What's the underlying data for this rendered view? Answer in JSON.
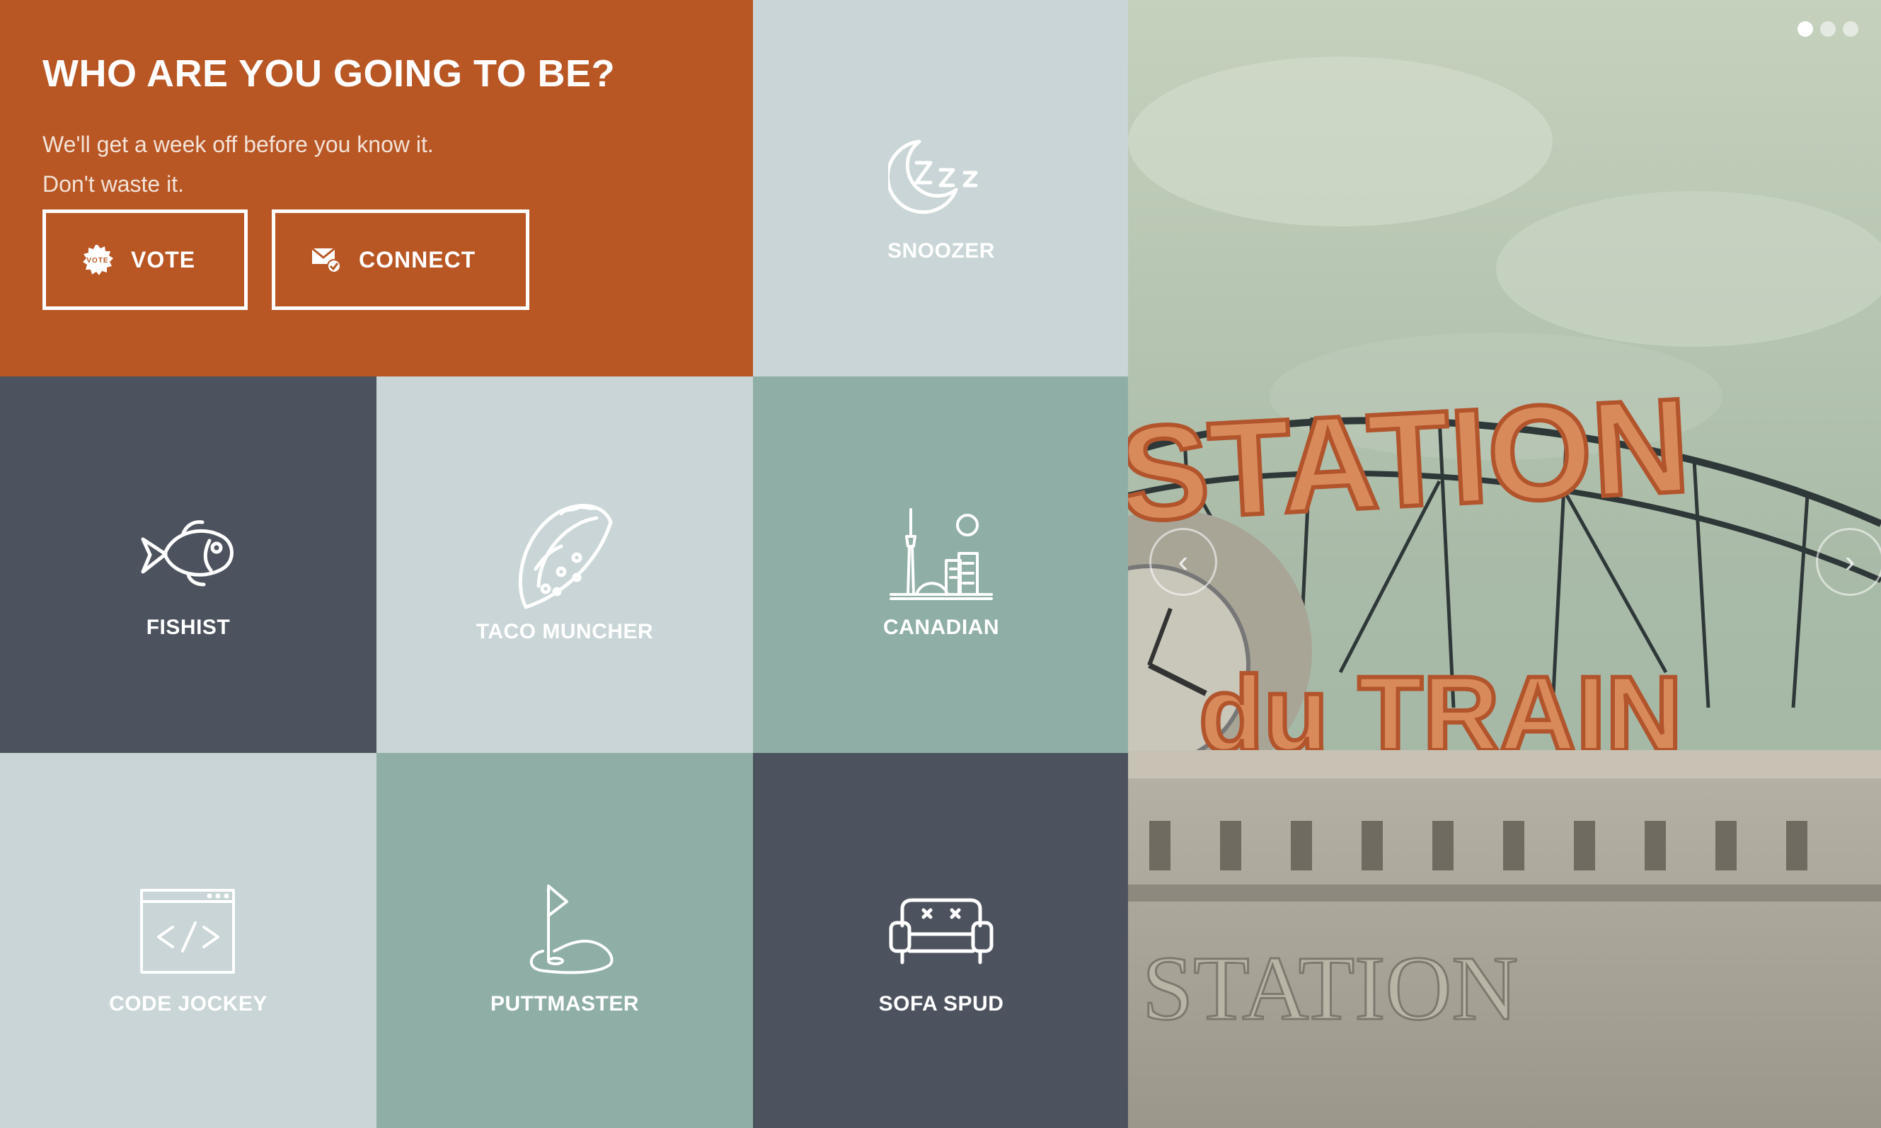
{
  "hero": {
    "title": "WHO ARE YOU GOING TO BE?",
    "line1": "We'll get a week off before you know it.",
    "line2": "Don't waste it.",
    "vote_label": "VOTE",
    "vote_icon": "vote-badge-icon",
    "connect_label": "CONNECT",
    "connect_icon": "mail-check-icon",
    "background": "#b85624"
  },
  "tiles": {
    "snoozer": {
      "label": "SNOOZER",
      "icon": "moon-zzz-icon",
      "color": "#c9d5d6"
    },
    "fishist": {
      "label": "FISHIST",
      "icon": "fish-icon",
      "color": "#4d535e"
    },
    "taco_muncher": {
      "label": "TACO MUNCHER",
      "icon": "taco-icon",
      "color": "#c9d5d6"
    },
    "canadian": {
      "label": "CANADIAN",
      "icon": "city-skyline-icon",
      "color": "#8fafa6"
    },
    "code_jockey": {
      "label": "CODE JOCKEY",
      "icon": "code-window-icon",
      "color": "#c9d5d6"
    },
    "puttmaster": {
      "label": "PUTTMASTER",
      "icon": "golf-flag-icon",
      "color": "#8fafa6"
    },
    "sofa_spud": {
      "label": "SOFA SPUD",
      "icon": "sofa-icon",
      "color": "#4d535e"
    }
  },
  "carousel": {
    "slides": 3,
    "active_slide": 1,
    "prev_icon": "chevron-left-icon",
    "next_icon": "chevron-right-icon",
    "prev_glyph": "‹",
    "next_glyph": "›"
  }
}
